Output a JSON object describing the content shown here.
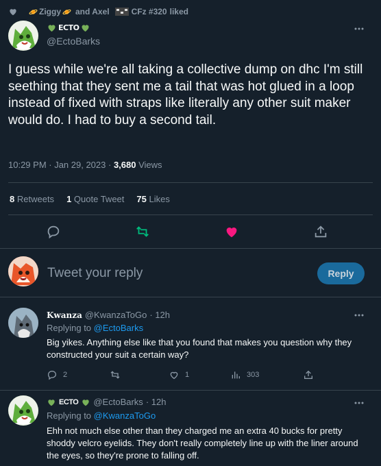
{
  "liked_by": {
    "first": "Ziggy",
    "middle": "and Axel",
    "last": "CFz #320",
    "suffix": "liked"
  },
  "tweet": {
    "display_name": "ECTO",
    "handle": "@EctoBarks",
    "text": "I guess while we're all taking a collective dump on dhc I'm still seething that they sent me a tail that was hot glued in a loop instead of fixed with straps like literally any other suit maker would do. I had to buy a second tail.",
    "timestamp": "10:29 PM · Jan 29, 2023 · ",
    "views_count": "3,680",
    "views_label": " Views"
  },
  "stats": {
    "retweets_count": "8",
    "retweets_label": "Retweets",
    "quotes_count": "1",
    "quotes_label": "Quote Tweet",
    "likes_count": "75",
    "likes_label": "Likes"
  },
  "composer": {
    "placeholder": "Tweet your reply",
    "button_label": "Reply"
  },
  "replies": [
    {
      "name": "Kwanza",
      "handle": "@KwanzaToGo",
      "time": "· 12h",
      "replying_label": "Replying to ",
      "replying_to": "@EctoBarks",
      "text": "Big yikes. Anything else like that you found that makes you question why they constructed your suit a certain way?",
      "reply_count": "2",
      "retweet_count": "",
      "like_count": "1",
      "view_count": "303"
    },
    {
      "name": "ECTO",
      "handle": "@EctoBarks",
      "time": "· 12h",
      "replying_label": "Replying to ",
      "replying_to": "@KwanzaToGo",
      "text": "Ehh not much else other than they charged me an extra 40 bucks for pretty shoddy velcro eyelids. They don't really completely line up with the liner around the eyes, so they're prone to falling off."
    }
  ],
  "colors": {
    "background": "#15202b",
    "accent": "#1d9bf0",
    "like_pink": "#f91880",
    "retweet_green": "#00ba7c",
    "heart_green": "#78b159"
  }
}
